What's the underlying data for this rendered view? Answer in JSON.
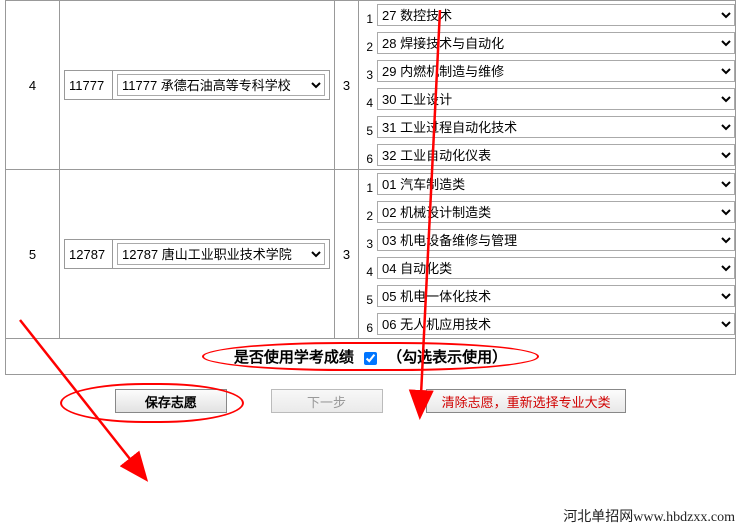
{
  "rows": [
    {
      "idx": "4",
      "school_pre": "11777",
      "school_sel": "11777 承德石油高等专科学校",
      "majors": [
        "27 数控技术",
        "28 焊接技术与自动化",
        "29 内燃机制造与维修",
        "30 工业设计",
        "31 工业过程自动化技术",
        "32 工业自动化仪表"
      ]
    },
    {
      "idx": "5",
      "school_pre": "12787",
      "school_sel": "12787 唐山工业职业技术学院",
      "majors": [
        "01 汽车制造类",
        "02 机械设计制造类",
        "03 机电设备维修与管理",
        "04 自动化类",
        "05 机电一体化技术",
        "06 无人机应用技术"
      ]
    }
  ],
  "checkbox": {
    "label_left": "是否使用学考成绩",
    "label_right": "（勾选表示使用）",
    "checked": true
  },
  "buttons": {
    "save": "保存志愿",
    "next": "下一步",
    "clear": "清除志愿，重新选择专业大类"
  },
  "watermark": "河北单招网www.hbdzxx.com",
  "slot_nums": [
    "1",
    "2",
    "3",
    "4",
    "5",
    "6"
  ]
}
